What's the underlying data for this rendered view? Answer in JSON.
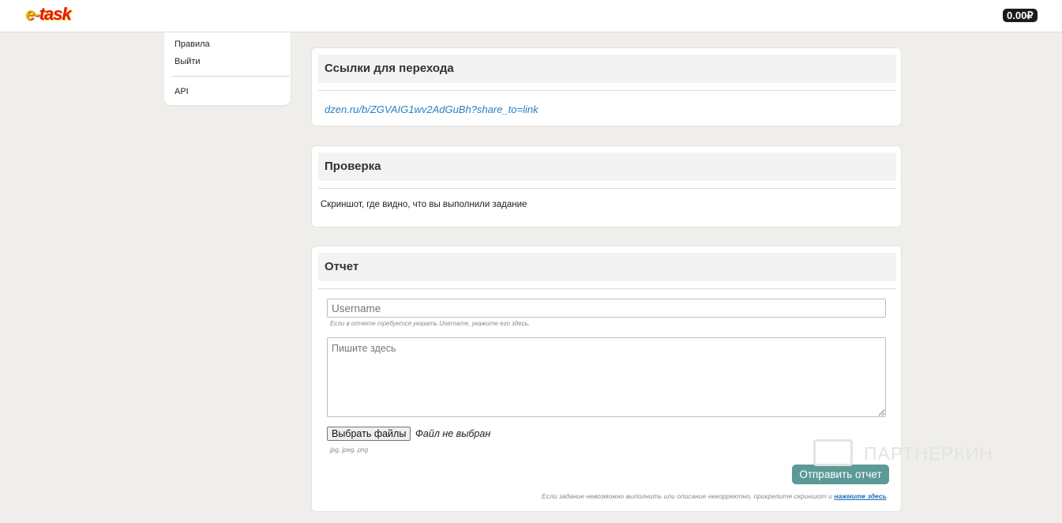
{
  "header": {
    "logo_e": "e-",
    "logo_task": "task",
    "balance": "0.00₽"
  },
  "sidebar": {
    "items": [
      {
        "label": "Правила"
      },
      {
        "label": "Выйти"
      },
      {
        "label": "API"
      }
    ]
  },
  "links_card": {
    "title": "Ссылки для перехода",
    "link": "dzen.ru/b/ZGVAIG1wv2AdGuBh?share_to=link"
  },
  "check_card": {
    "title": "Проверка",
    "text": "Скриншот, где видно, что вы выполнили задание"
  },
  "report_card": {
    "title": "Отчет",
    "username_placeholder": "Username",
    "username_hint": "Если в отчете требуется указать Username, укажите его здесь.",
    "text_placeholder": "Пишите здесь",
    "file_button": "Выбрать файлы",
    "file_status": "Файл не выбран",
    "file_types": "jpg, jpeg, png",
    "submit": "Отправить отчет",
    "footnote_text": "Если задание невозможно выполнить или описание некорректно, прикрепите скриншот и",
    "footnote_link": "нажмите здесь",
    "footnote_end": "."
  },
  "watermark": {
    "text": "ПАРТНЕРКИН"
  }
}
